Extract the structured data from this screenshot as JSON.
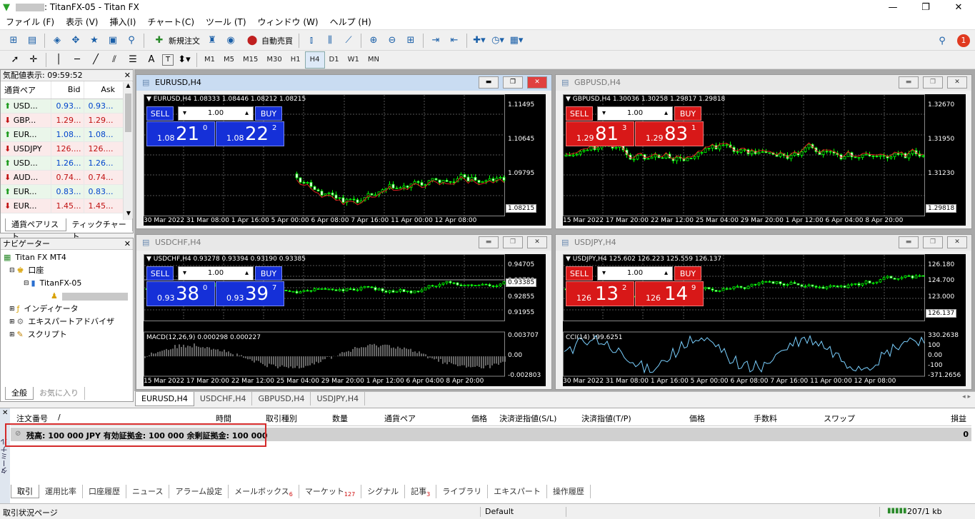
{
  "titlebar": {
    "title": ": TitanFX-05 - Titan FX",
    "minimize": "—",
    "maximize": "❐",
    "close": "✕"
  },
  "menu": [
    "ファイル (F)",
    "表示 (V)",
    "挿入(I)",
    "チャート(C)",
    "ツール (T)",
    "ウィンドウ (W)",
    "ヘルプ (H)"
  ],
  "toolbar": {
    "new_order": "新規注文",
    "auto_trade": "自動売買",
    "alert_count": "1"
  },
  "timeframes": [
    "M1",
    "M5",
    "M15",
    "M30",
    "H1",
    "H4",
    "D1",
    "W1",
    "MN"
  ],
  "timeframe_selected": "H4",
  "drawing_labels": {
    "text_tool": "A",
    "label_tool": "T"
  },
  "market_watch": {
    "header": "気配値表示: 09:59:52",
    "columns": [
      "通貨ペア",
      "Bid",
      "Ask"
    ],
    "rows": [
      {
        "symbol": "USD...",
        "bid": "0.93...",
        "ask": "0.93...",
        "dir": "up"
      },
      {
        "symbol": "GBP...",
        "bid": "1.29...",
        "ask": "1.29...",
        "dir": "down"
      },
      {
        "symbol": "EUR...",
        "bid": "1.08...",
        "ask": "1.08...",
        "dir": "up"
      },
      {
        "symbol": "USDJPY",
        "bid": "126....",
        "ask": "126....",
        "dir": "down"
      },
      {
        "symbol": "USD...",
        "bid": "1.26...",
        "ask": "1.26...",
        "dir": "up"
      },
      {
        "symbol": "AUD...",
        "bid": "0.74...",
        "ask": "0.74...",
        "dir": "down"
      },
      {
        "symbol": "EUR...",
        "bid": "0.83...",
        "ask": "0.83...",
        "dir": "up"
      },
      {
        "symbol": "EUR...",
        "bid": "1.45...",
        "ask": "1.45...",
        "dir": "down"
      }
    ],
    "tabs": [
      "通貨ペアリスト",
      "ティックチャート"
    ]
  },
  "navigator": {
    "header": "ナビゲーター",
    "root": "Titan FX MT4",
    "accounts": "口座",
    "account": "TitanFX-05",
    "indicators": "インディケータ",
    "experts": "エキスパートアドバイザ",
    "scripts": "スクリプト",
    "tabs": [
      "全般",
      "お気に入り"
    ]
  },
  "charts": [
    {
      "window_title": "EURUSD,H4",
      "ohlc": "EURUSD,H4  1.08333 1.08446 1.08212 1.08215",
      "color": "blue",
      "lot": "1.00",
      "sell": {
        "small": "1.08",
        "big": "21",
        "sup": "0"
      },
      "buy": {
        "small": "1.08",
        "big": "22",
        "sup": "2"
      },
      "price_scale": [
        "1.11495",
        "1.10645",
        "1.09795",
        "1.08945"
      ],
      "current_price": "1.08215",
      "time_scale": "30 Mar 2022    31 Mar 08:00    1 Apr 16:00    5 Apr 00:00    6 Apr 08:00    7 Apr 16:00    11 Apr 00:00    12 Apr 08:00",
      "indicator": "",
      "indicator_scale": []
    },
    {
      "window_title": "GBPUSD,H4",
      "ohlc": "GBPUSD,H4  1.30036 1.30258 1.29817 1.29818",
      "color": "red",
      "lot": "1.00",
      "sell": {
        "small": "1.29",
        "big": "81",
        "sup": "3"
      },
      "buy": {
        "small": "1.29",
        "big": "83",
        "sup": "1"
      },
      "price_scale": [
        "1.32670",
        "1.31950",
        "1.31230",
        "1.30510"
      ],
      "current_price": "1.29818",
      "time_scale": "15 Mar 2022    17 Mar 20:00    22 Mar 12:00    25 Mar 04:00    29 Mar 20:00    1 Apr 12:00    6 Apr 04:00    8 Apr 20:00",
      "indicator": "",
      "indicator_scale": []
    },
    {
      "window_title": "USDCHF,H4",
      "ohlc": "USDCHF,H4  0.93278 0.93394 0.93190 0.93385",
      "color": "blue",
      "lot": "1.00",
      "sell": {
        "small": "0.93",
        "big": "38",
        "sup": "0"
      },
      "buy": {
        "small": "0.93",
        "big": "39",
        "sup": "7"
      },
      "price_scale": [
        "0.94705",
        "0.93780",
        "0.92855",
        "0.91955"
      ],
      "current_price": "0.93385",
      "time_scale": "15 Mar 2022    17 Mar 20:00    22 Mar 12:00    25 Mar 04:00    29 Mar 20:00    1 Apr 12:00    6 Apr 04:00    8 Apr 20:00",
      "indicator": "MACD(12,26,9) 0.000298 0.000227",
      "indicator_scale": [
        "0.003707",
        "0.00",
        "-0.002803"
      ]
    },
    {
      "window_title": "USDJPY,H4",
      "ohlc": "USDJPY,H4  125.602 126.223 125.559 126.137",
      "color": "red",
      "lot": "1.00",
      "sell": {
        "small": "126",
        "big": "13",
        "sup": "2"
      },
      "buy": {
        "small": "126",
        "big": "14",
        "sup": "9"
      },
      "price_scale": [
        "126.180",
        "124.700",
        "123.000",
        "121.300"
      ],
      "current_price": "126.137",
      "time_scale": "30 Mar 2022    31 Mar 08:00    1 Apr 16:00    5 Apr 00:00    6 Apr 08:00    7 Apr 16:00    11 Apr 00:00    12 Apr 08:00",
      "indicator": "CCI(14) 199.6251",
      "indicator_scale": [
        "330.2638",
        "100",
        "0.00",
        "-100",
        "-371.2656"
      ]
    }
  ],
  "chart_tabs": [
    "EURUSD,H4",
    "USDCHF,H4",
    "GBPUSD,H4",
    "USDJPY,H4"
  ],
  "terminal": {
    "side_label": "ターミナル",
    "columns": [
      "注文番号",
      "/",
      "時間",
      "取引種別",
      "数量",
      "通貨ペア",
      "価格",
      "決済逆指値(S/L)",
      "決済指値(T/P)",
      "価格",
      "手数料",
      "スワップ",
      "損益"
    ],
    "balance_line": "残高: 100 000 JPY  有効証拠金: 100 000  余剰証拠金: 100 000",
    "profit": "0",
    "tabs": [
      {
        "label": "取引",
        "badge": ""
      },
      {
        "label": "運用比率",
        "badge": ""
      },
      {
        "label": "口座履歴",
        "badge": ""
      },
      {
        "label": "ニュース",
        "badge": ""
      },
      {
        "label": "アラーム設定",
        "badge": ""
      },
      {
        "label": "メールボックス",
        "badge": "6"
      },
      {
        "label": "マーケット",
        "badge": "127"
      },
      {
        "label": "シグナル",
        "badge": ""
      },
      {
        "label": "記事",
        "badge": "3"
      },
      {
        "label": "ライブラリ",
        "badge": ""
      },
      {
        "label": "エキスパート",
        "badge": ""
      },
      {
        "label": "操作履歴",
        "badge": ""
      }
    ]
  },
  "statusbar": {
    "left": "取引状況ページ",
    "profile": "Default",
    "traffic": "207/1 kb"
  }
}
